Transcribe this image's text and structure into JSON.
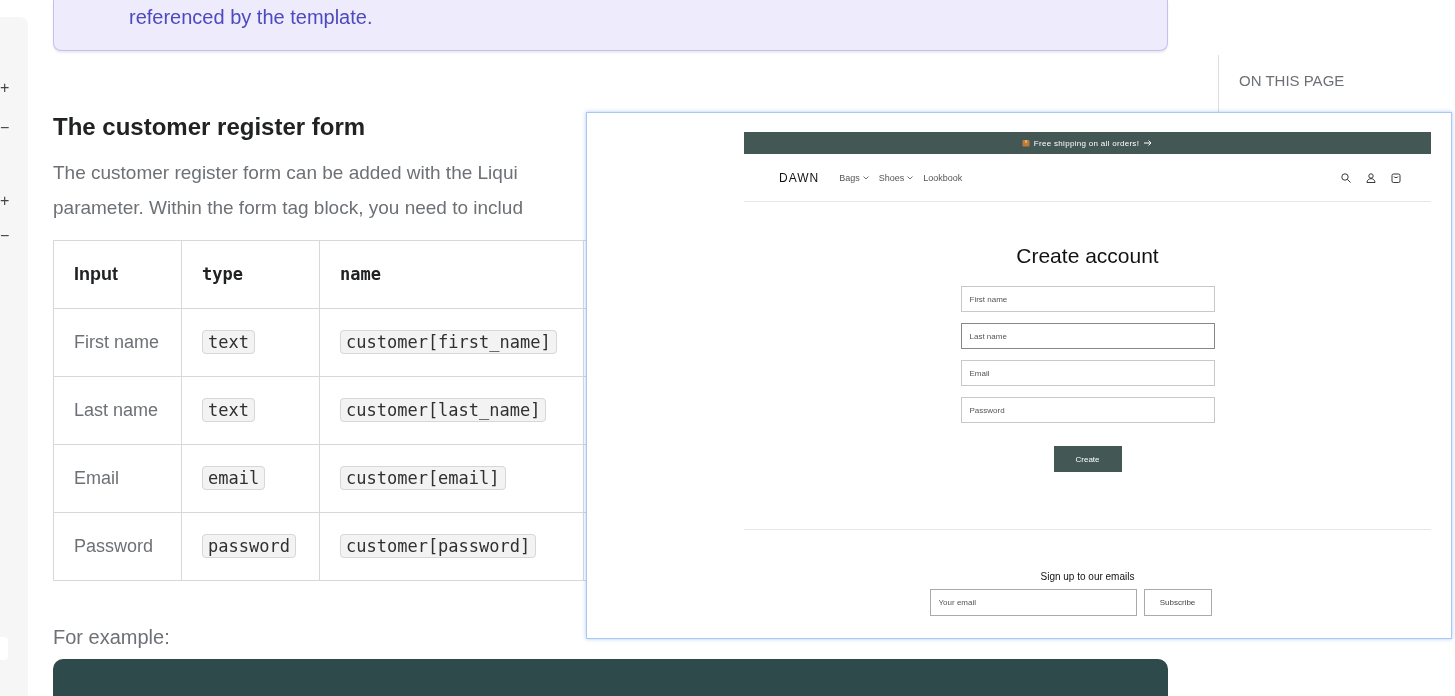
{
  "callout": {
    "text": "referenced by the template."
  },
  "sidebar": {
    "controls": [
      "+",
      "−",
      "+",
      "−"
    ]
  },
  "section": {
    "heading": "The customer register form",
    "paragraph_lines": [
      "The customer register form can be added with the Liqui",
      "parameter. Within the form tag block, you need to includ"
    ],
    "table": {
      "columns": [
        {
          "label": "Input",
          "code": false
        },
        {
          "label": "type",
          "code": true
        },
        {
          "label": "name",
          "code": true
        }
      ],
      "rows": [
        {
          "input": "First name",
          "type": "text",
          "name": "customer[first_name]"
        },
        {
          "input": "Last name",
          "type": "text",
          "name": "customer[last_name]"
        },
        {
          "input": "Email",
          "type": "email",
          "name": "customer[email]"
        },
        {
          "input": "Password",
          "type": "password",
          "name": "customer[password]"
        }
      ]
    },
    "example_label": "For example:"
  },
  "toc": {
    "title": "ON THIS PAGE"
  },
  "preview": {
    "announcement": "Free shipping on all orders!",
    "logo": "DAWN",
    "nav": [
      {
        "label": "Bags",
        "dropdown": true
      },
      {
        "label": "Shoes",
        "dropdown": true
      },
      {
        "label": "Lookbook",
        "dropdown": false
      }
    ],
    "title": "Create account",
    "fields": [
      {
        "placeholder": "First name",
        "focused": false
      },
      {
        "placeholder": "Last name",
        "focused": true
      },
      {
        "placeholder": "Email",
        "focused": false
      },
      {
        "placeholder": "Password",
        "focused": false
      }
    ],
    "submit": "Create",
    "newsletter": {
      "title": "Sign up to our emails",
      "placeholder": "Your email",
      "button": "Subscribe"
    }
  }
}
